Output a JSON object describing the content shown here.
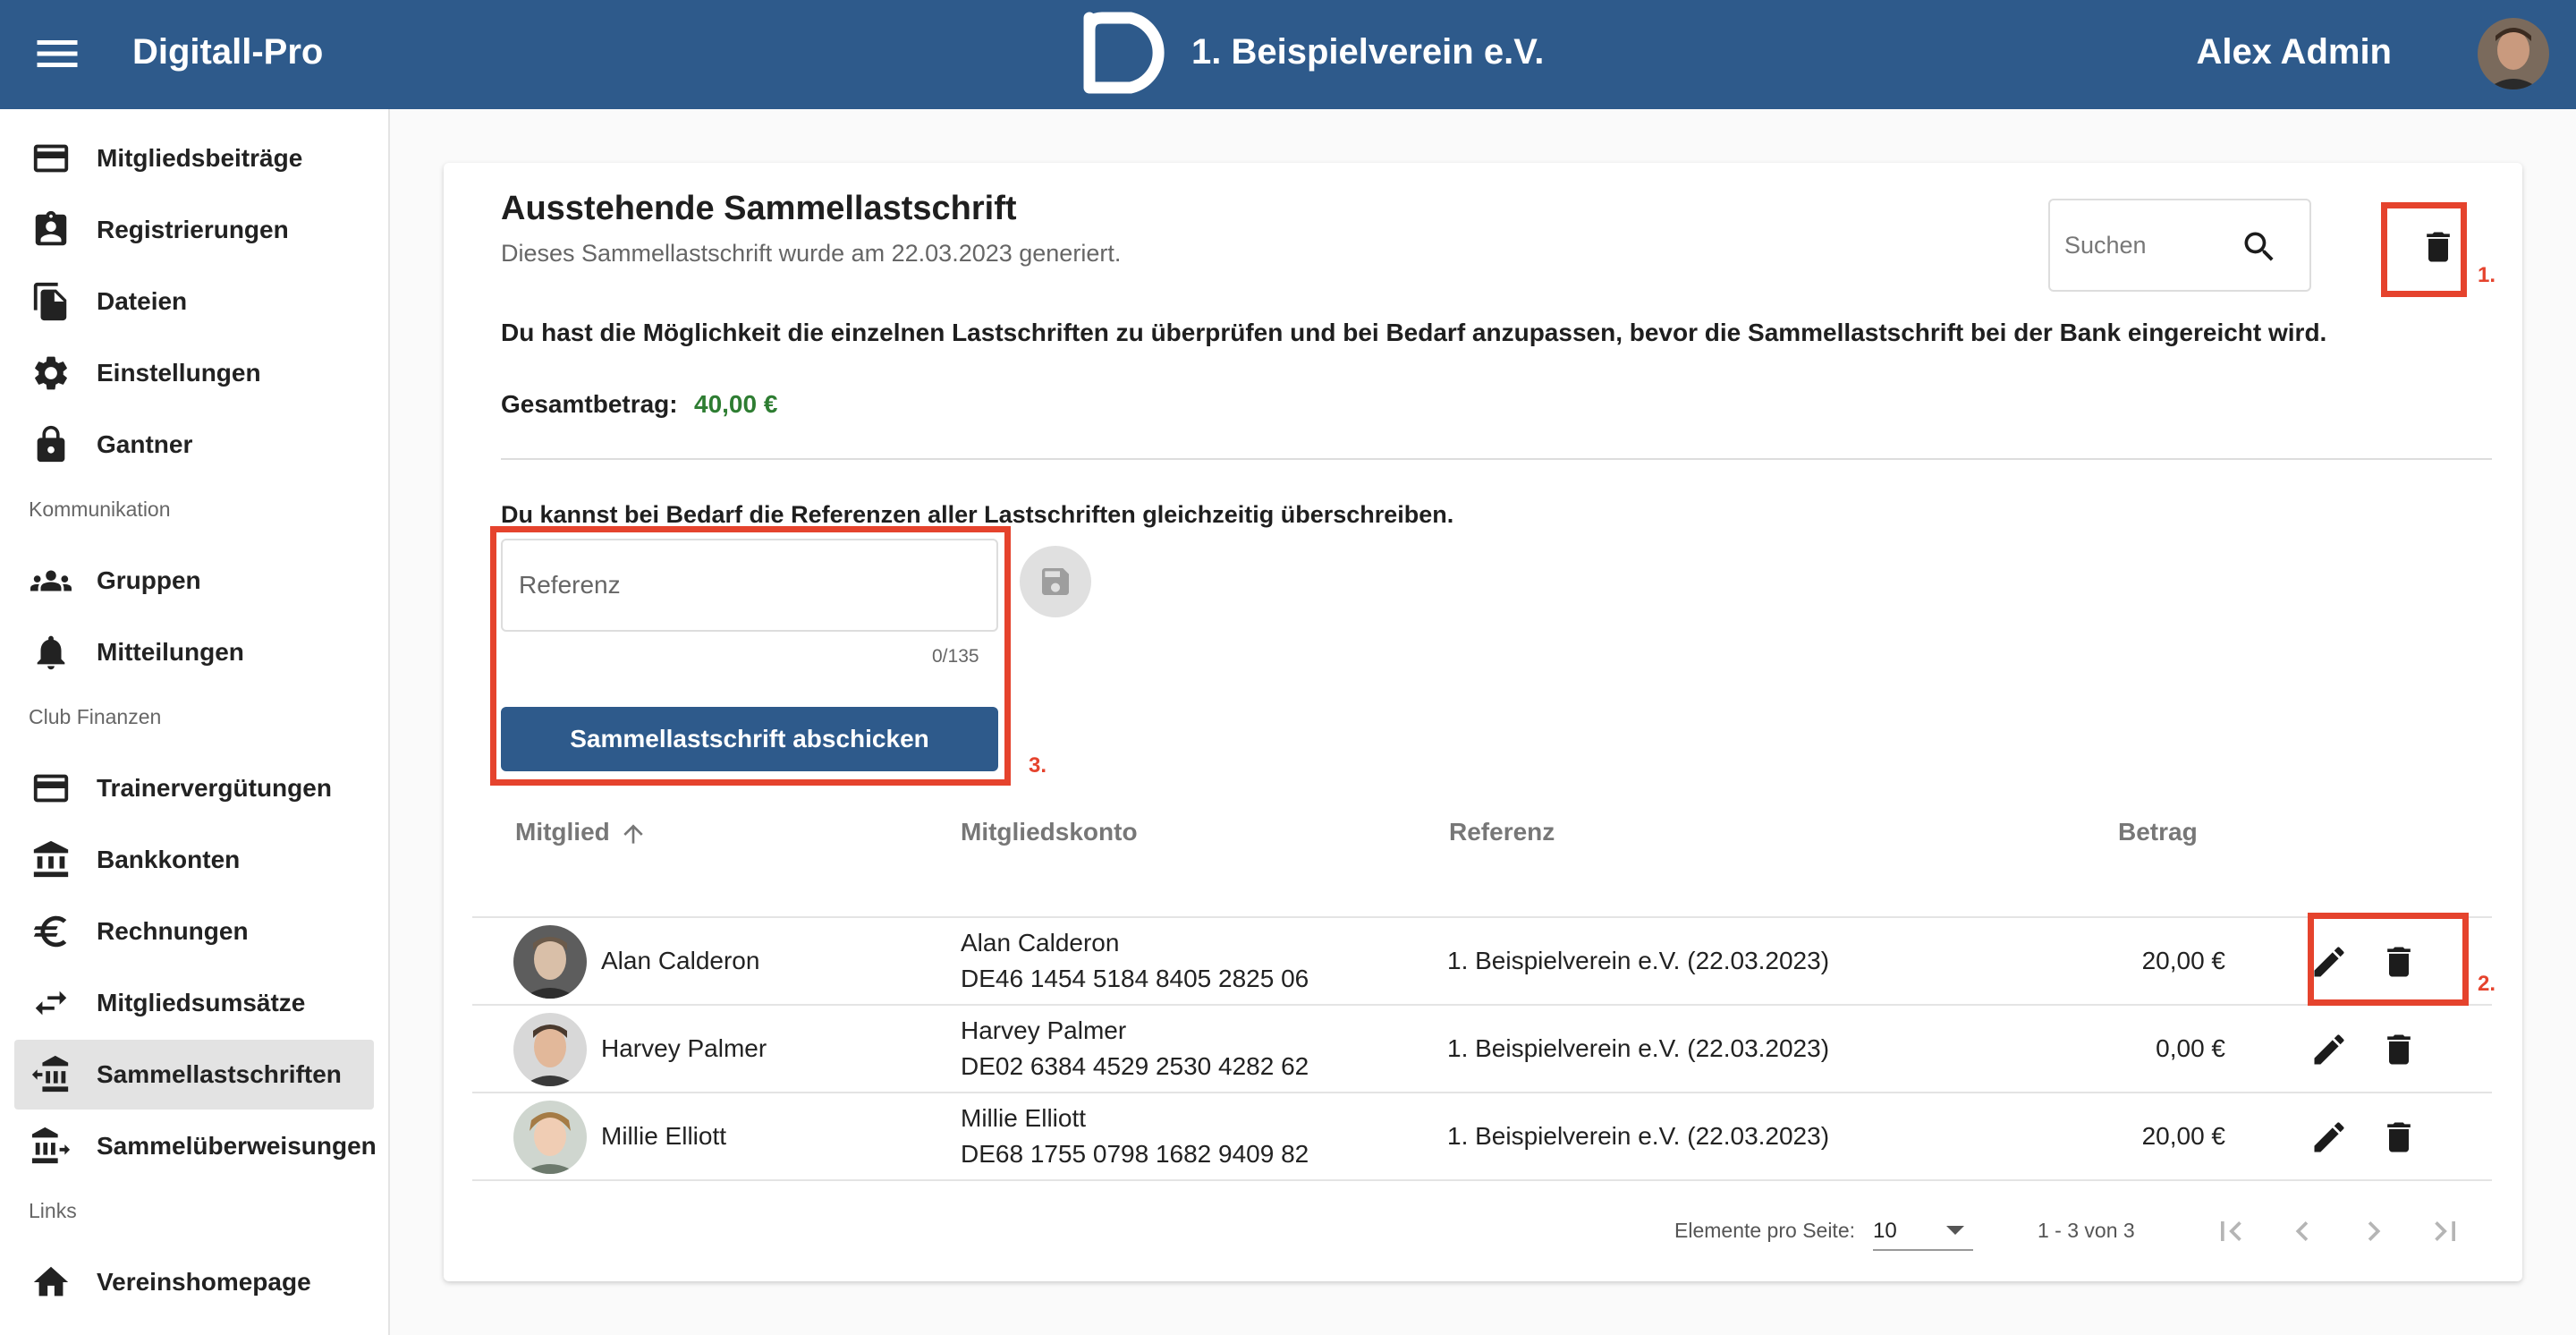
{
  "header": {
    "app_title": "Digitall-Pro",
    "club_name": "1. Beispielverein e.V.",
    "user_name": "Alex Admin",
    "bar_color": "#2e5a8b"
  },
  "sidebar": {
    "items": [
      {
        "label": "Mitgliedsbeiträge",
        "icon": "credit-card-icon"
      },
      {
        "label": "Registrierungen",
        "icon": "badge-icon"
      },
      {
        "label": "Dateien",
        "icon": "files-icon"
      },
      {
        "label": "Einstellungen",
        "icon": "gear-icon"
      },
      {
        "label": "Gantner",
        "icon": "lock-icon"
      }
    ],
    "section_kommunikation": "Kommunikation",
    "kommunikation_items": [
      {
        "label": "Gruppen",
        "icon": "group-icon"
      },
      {
        "label": "Mitteilungen",
        "icon": "bell-icon"
      }
    ],
    "section_finanzen": "Club Finanzen",
    "finanzen_items": [
      {
        "label": "Trainervergütungen",
        "icon": "credit-card-icon"
      },
      {
        "label": "Bankkonten",
        "icon": "bank-icon"
      },
      {
        "label": "Rechnungen",
        "icon": "euro-icon"
      },
      {
        "label": "Mitgliedsumsätze",
        "icon": "swap-icon"
      },
      {
        "label": "Sammellastschriften",
        "icon": "bank-in-icon",
        "active": true
      },
      {
        "label": "Sammelüberweisungen",
        "icon": "bank-out-icon"
      }
    ],
    "section_links": "Links",
    "links_items": [
      {
        "label": "Vereinshomepage",
        "icon": "home-icon"
      }
    ]
  },
  "main": {
    "title": "Ausstehende Sammellastschrift",
    "subtitle": "Dieses Sammellastschrift wurde am 22.03.2023 generiert.",
    "search_placeholder": "Suchen",
    "info_text": "Du hast die Möglichkeit die einzelnen Lastschriften zu überprüfen und bei Bedarf anzupassen, bevor die Sammellastschrift bei der Bank eingereicht wird.",
    "total_label": "Gesamtbetrag:",
    "total_value": "40,00 €",
    "total_color": "#2e7d32",
    "override_text": "Du kannst bei Bedarf die Referenzen aller Lastschriften gleichzeitig überschreiben.",
    "reference_placeholder": "Referenz",
    "reference_counter": "0/135",
    "submit_label": "Sammellastschrift abschicken",
    "annotations": {
      "one": "1.",
      "two": "2.",
      "three": "3.",
      "color": "#e5432d"
    }
  },
  "table": {
    "headers": {
      "member": "Mitglied",
      "account": "Mitgliedskonto",
      "reference": "Referenz",
      "amount": "Betrag"
    },
    "rows": [
      {
        "name": "Alan Calderon",
        "account_name": "Alan Calderon",
        "iban": "DE46 1454 5184 8405 2825 06",
        "reference": "1. Beispielverein e.V. (22.03.2023)",
        "amount": "20,00 €"
      },
      {
        "name": "Harvey Palmer",
        "account_name": "Harvey Palmer",
        "iban": "DE02 6384 4529 2530 4282 62",
        "reference": "1. Beispielverein e.V. (22.03.2023)",
        "amount": "0,00 €"
      },
      {
        "name": "Millie Elliott",
        "account_name": "Millie Elliott",
        "iban": "DE68 1755 0798 1682 9409 82",
        "reference": "1. Beispielverein e.V. (22.03.2023)",
        "amount": "20,00 €"
      }
    ]
  },
  "paginator": {
    "items_per_page_label": "Elemente pro Seite:",
    "items_per_page": "10",
    "range": "1 - 3 von 3"
  }
}
